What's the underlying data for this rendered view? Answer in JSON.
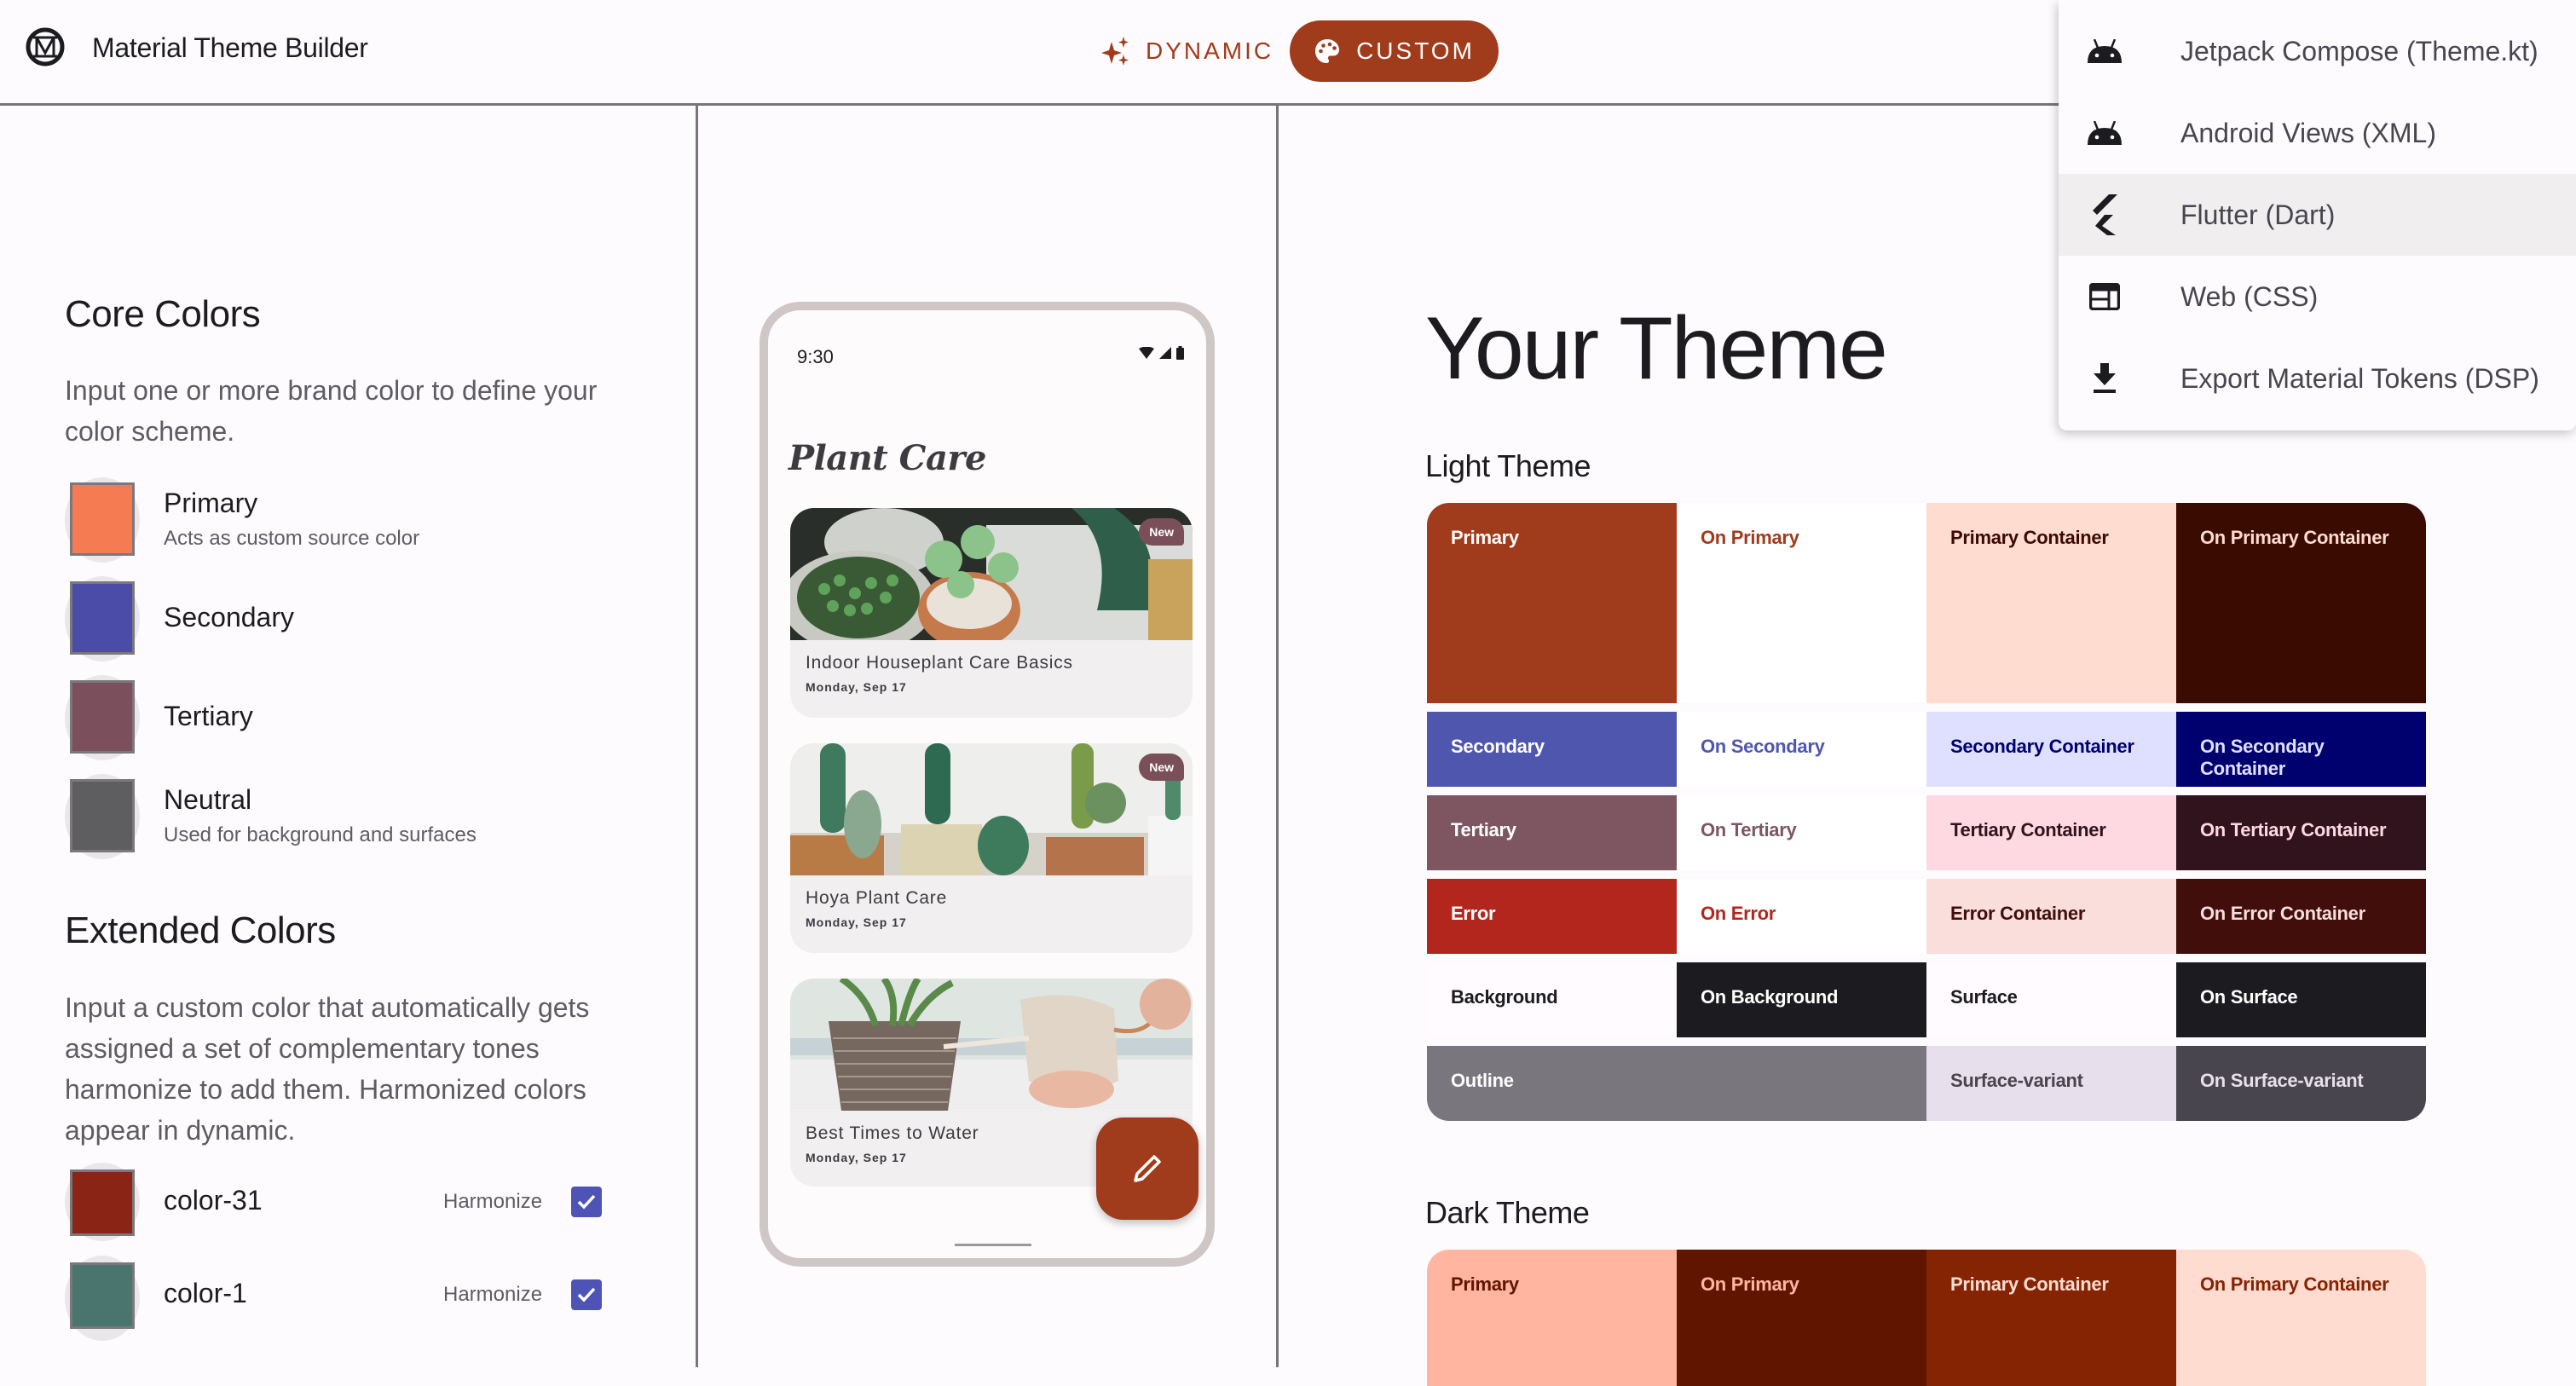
{
  "header": {
    "app_title": "Material Theme Builder",
    "logo_icon": "material-logo-icon",
    "modes": [
      {
        "label": "DYNAMIC",
        "icon": "sparkle-icon",
        "selected": false
      },
      {
        "label": "CUSTOM",
        "icon": "palette-icon",
        "selected": true
      }
    ]
  },
  "export_menu": {
    "items": [
      {
        "label": "Jetpack Compose (Theme.kt)",
        "icon": "android-icon"
      },
      {
        "label": "Android Views (XML)",
        "icon": "android-icon"
      },
      {
        "label": "Flutter (Dart)",
        "icon": "flutter-icon",
        "hovered": true
      },
      {
        "label": "Web (CSS)",
        "icon": "web-icon"
      },
      {
        "label": "Export Material Tokens (DSP)",
        "icon": "download-icon"
      }
    ]
  },
  "core_colors": {
    "title": "Core Colors",
    "description": "Input one or more brand color to define your color scheme.",
    "items": [
      {
        "name": "Primary",
        "subtitle": "Acts as custom source color",
        "color": "#f47b52"
      },
      {
        "name": "Secondary",
        "subtitle": "",
        "color": "#4a4ca8"
      },
      {
        "name": "Tertiary",
        "subtitle": "",
        "color": "#7c4f5d"
      },
      {
        "name": "Neutral",
        "subtitle": "Used for background and surfaces",
        "color": "#5e5d60"
      }
    ]
  },
  "extended_colors": {
    "title": "Extended Colors",
    "description": "Input a custom color that automatically gets assigned a set of complementary tones harmonize to add them. Harmonized colors appear in dynamic.",
    "items": [
      {
        "name": "color-31",
        "color": "#8a2414",
        "harmonize_label": "Harmonize",
        "harmonize": true
      },
      {
        "name": "color-1",
        "color": "#4a756f",
        "harmonize_label": "Harmonize",
        "harmonize": true
      }
    ]
  },
  "phone_preview": {
    "status_time": "9:30",
    "app_title": "Plant Care",
    "cards": [
      {
        "title": "Indoor Houseplant Care Basics",
        "date": "Monday, Sep 17",
        "badge": "New"
      },
      {
        "title": "Hoya Plant Care",
        "date": "Monday, Sep 17",
        "badge": "New"
      },
      {
        "title": "Best Times to Water",
        "date": "Monday, Sep 17",
        "badge": ""
      }
    ],
    "fab_icon": "edit-pencil-icon"
  },
  "theme": {
    "title": "Your Theme",
    "light_title": "Light Theme",
    "dark_title": "Dark Theme",
    "light_rows": [
      [
        {
          "label": "Primary",
          "bg": "#a03b1b",
          "fg": "#ffffff"
        },
        {
          "label": "On Primary",
          "bg": "#ffffff",
          "fg": "#a03b1b"
        },
        {
          "label": "Primary Container",
          "bg": "#ffdbd0",
          "fg": "#3a0b00"
        },
        {
          "label": "On Primary Container",
          "bg": "#3a0b00",
          "fg": "#ffdbd0"
        }
      ],
      [
        {
          "label": "Secondary",
          "bg": "#4f56ad",
          "fg": "#ffffff"
        },
        {
          "label": "On Secondary",
          "bg": "#ffffff",
          "fg": "#4f56ad"
        },
        {
          "label": "Secondary Container",
          "bg": "#dfe0ff",
          "fg": "#00006e"
        },
        {
          "label": "On Secondary Container",
          "bg": "#00006e",
          "fg": "#dfe0ff"
        }
      ],
      [
        {
          "label": "Tertiary",
          "bg": "#7d5662",
          "fg": "#ffffff"
        },
        {
          "label": "On Tertiary",
          "bg": "#ffffff",
          "fg": "#7d5662"
        },
        {
          "label": "Tertiary Container",
          "bg": "#ffd9e2",
          "fg": "#31131e"
        },
        {
          "label": "On Tertiary Container",
          "bg": "#31131e",
          "fg": "#ffd9e2"
        }
      ],
      [
        {
          "label": "Error",
          "bg": "#b3261e",
          "fg": "#ffffff"
        },
        {
          "label": "On Error",
          "bg": "#ffffff",
          "fg": "#b3261e"
        },
        {
          "label": "Error Container",
          "bg": "#f9dedc",
          "fg": "#410e0b"
        },
        {
          "label": "On Error Container",
          "bg": "#410e0b",
          "fg": "#f9dedc"
        }
      ],
      [
        {
          "label": "Background",
          "bg": "#fffbff",
          "fg": "#1c1b1f"
        },
        {
          "label": "On Background",
          "bg": "#1c1b1f",
          "fg": "#ffffff"
        },
        {
          "label": "Surface",
          "bg": "#fffbff",
          "fg": "#1c1b1f"
        },
        {
          "label": "On Surface",
          "bg": "#1c1b1f",
          "fg": "#ffffff"
        }
      ],
      [
        {
          "label": "Outline",
          "bg": "#79767d",
          "fg": "#ffffff",
          "span": 2
        },
        {
          "label": "Surface-variant",
          "bg": "#e7e0ec",
          "fg": "#49454f"
        },
        {
          "label": "On Surface-variant",
          "bg": "#49454f",
          "fg": "#e7e0ec"
        }
      ]
    ],
    "dark_rows": [
      [
        {
          "label": "Primary",
          "bg": "#ffb59f",
          "fg": "#5f1500"
        },
        {
          "label": "On Primary",
          "bg": "#5f1500",
          "fg": "#ffb59f"
        },
        {
          "label": "Primary Container",
          "bg": "#852403",
          "fg": "#ffdbd0"
        },
        {
          "label": "On Primary Container",
          "bg": "#ffdbd0",
          "fg": "#852403"
        }
      ]
    ]
  }
}
